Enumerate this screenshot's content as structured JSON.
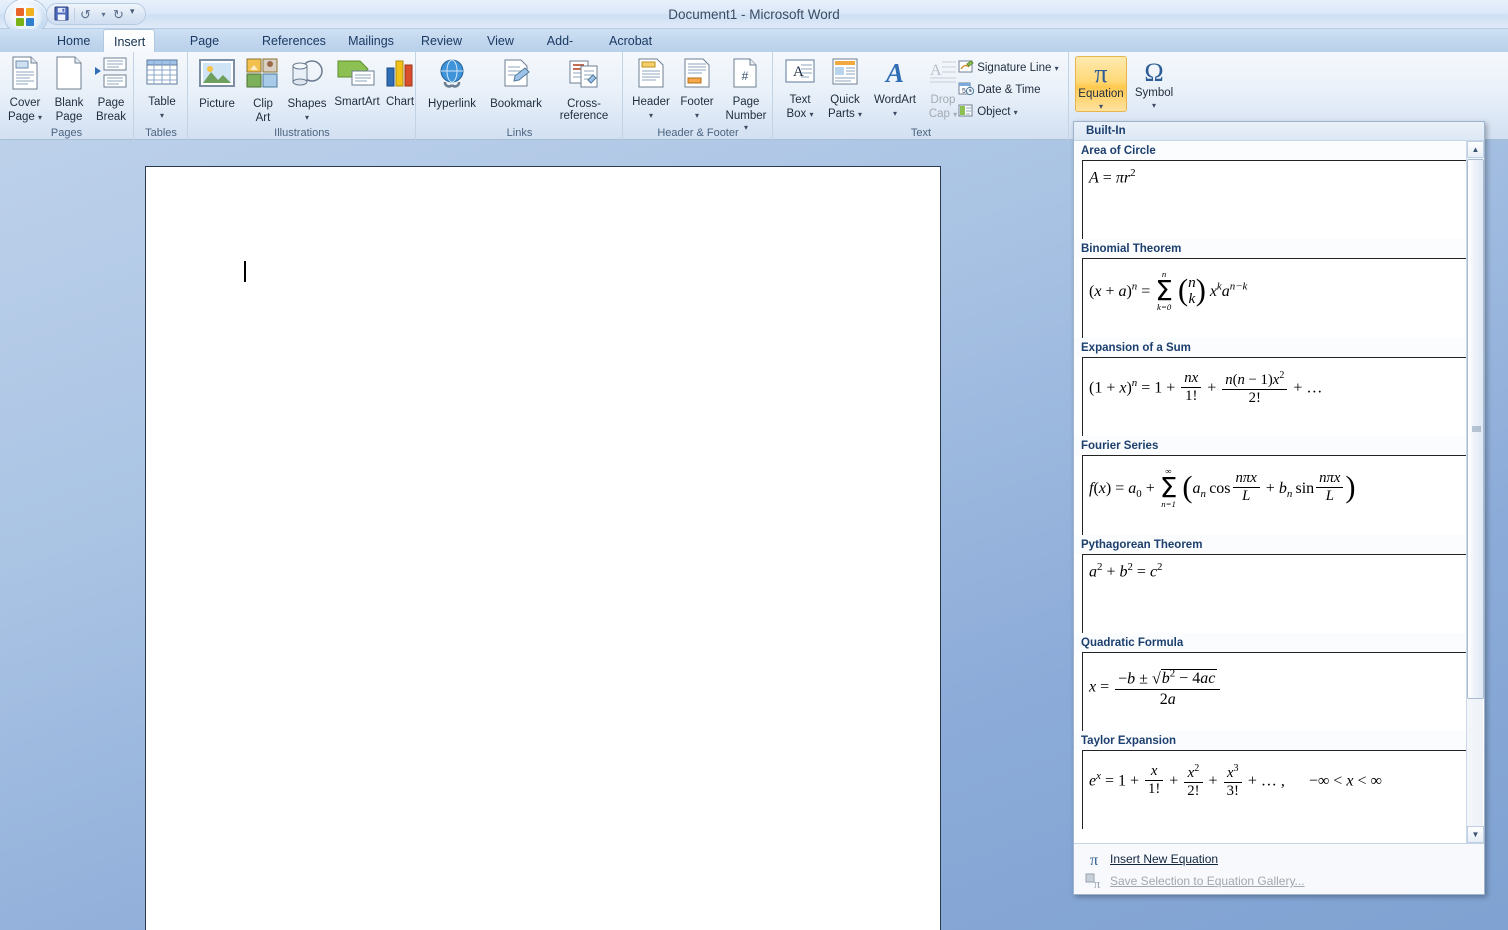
{
  "window": {
    "title": "Document1 - Microsoft Word"
  },
  "quick_access": {
    "items": [
      {
        "name": "save-button",
        "icon": "save-icon",
        "glyph": "💾"
      },
      {
        "name": "undo-button",
        "icon": "undo-icon",
        "glyph": "↶"
      },
      {
        "name": "undo-dropdown",
        "icon": "chevron-down-icon",
        "glyph": "▾"
      },
      {
        "name": "redo-button",
        "icon": "redo-icon",
        "glyph": "↷"
      }
    ],
    "customize_glyph": "▾"
  },
  "tabs": [
    {
      "label": "Home",
      "active": false
    },
    {
      "label": "Insert",
      "active": true
    },
    {
      "label": "Page Layout",
      "active": false
    },
    {
      "label": "References",
      "active": false
    },
    {
      "label": "Mailings",
      "active": false
    },
    {
      "label": "Review",
      "active": false
    },
    {
      "label": "View",
      "active": false
    },
    {
      "label": "Add-Ins",
      "active": false
    },
    {
      "label": "Acrobat",
      "active": false
    }
  ],
  "ribbon": {
    "groups": [
      {
        "label": "Pages",
        "buttons": [
          {
            "line1": "Cover",
            "line2": "Page",
            "caret": "▾",
            "icon": "cover-page-icon"
          },
          {
            "line1": "Blank",
            "line2": "Page",
            "caret": "",
            "icon": "blank-page-icon"
          },
          {
            "line1": "Page",
            "line2": "Break",
            "caret": "",
            "icon": "page-break-icon"
          }
        ]
      },
      {
        "label": "Tables",
        "buttons": [
          {
            "line1": "Table",
            "line2": "",
            "caret": "▾",
            "icon": "table-icon"
          }
        ]
      },
      {
        "label": "Illustrations",
        "buttons": [
          {
            "line1": "Picture",
            "line2": "",
            "caret": "",
            "icon": "picture-icon"
          },
          {
            "line1": "Clip",
            "line2": "Art",
            "caret": "",
            "icon": "clip-art-icon"
          },
          {
            "line1": "Shapes",
            "line2": "",
            "caret": "▾",
            "icon": "shapes-icon"
          },
          {
            "line1": "SmartArt",
            "line2": "",
            "caret": "",
            "icon": "smartart-icon"
          },
          {
            "line1": "Chart",
            "line2": "",
            "caret": "",
            "icon": "chart-icon"
          }
        ]
      },
      {
        "label": "Links",
        "buttons": [
          {
            "line1": "Hyperlink",
            "line2": "",
            "caret": "",
            "icon": "hyperlink-icon"
          },
          {
            "line1": "Bookmark",
            "line2": "",
            "caret": "",
            "icon": "bookmark-icon"
          },
          {
            "line1": "Cross-reference",
            "line2": "",
            "caret": "",
            "icon": "cross-reference-icon"
          }
        ]
      },
      {
        "label": "Header & Footer",
        "buttons": [
          {
            "line1": "Header",
            "line2": "",
            "caret": "▾",
            "icon": "header-icon"
          },
          {
            "line1": "Footer",
            "line2": "",
            "caret": "▾",
            "icon": "footer-icon"
          },
          {
            "line1": "Page",
            "line2": "Number",
            "caret": "▾",
            "icon": "page-number-icon"
          }
        ]
      },
      {
        "label": "Text",
        "buttons": [
          {
            "line1": "Text",
            "line2": "Box",
            "caret": "▾",
            "icon": "text-box-icon"
          },
          {
            "line1": "Quick",
            "line2": "Parts",
            "caret": "▾",
            "icon": "quick-parts-icon"
          },
          {
            "line1": "WordArt",
            "line2": "",
            "caret": "▾",
            "icon": "wordart-icon"
          },
          {
            "line1": "Drop",
            "line2": "Cap",
            "caret": "▾",
            "icon": "drop-cap-icon",
            "disabled": true
          }
        ],
        "small_buttons": [
          {
            "label": "Signature Line",
            "caret": "▾",
            "icon": "signature-line-icon"
          },
          {
            "label": "Date & Time",
            "caret": "",
            "icon": "date-time-icon"
          },
          {
            "label": "Object",
            "caret": "▾",
            "icon": "object-icon"
          }
        ]
      },
      {
        "label": "",
        "buttons": [
          {
            "line1": "Equation",
            "line2": "",
            "caret": "▾",
            "icon": "pi-icon",
            "glyph": "π",
            "selected": true
          },
          {
            "line1": "Symbol",
            "line2": "",
            "caret": "▾",
            "icon": "omega-icon",
            "glyph": "Ω",
            "selected": false
          }
        ]
      }
    ]
  },
  "gallery": {
    "header": "Built-In",
    "scrollbar": {
      "up_glyph": "▲",
      "down_glyph": "▼"
    },
    "items": [
      {
        "label": "Area of Circle",
        "equation_id": "area-of-circle"
      },
      {
        "label": "Binomial Theorem",
        "equation_id": "binomial-theorem"
      },
      {
        "label": "Expansion of a Sum",
        "equation_id": "expansion-of-a-sum"
      },
      {
        "label": "Fourier Series",
        "equation_id": "fourier-series"
      },
      {
        "label": "Pythagorean Theorem",
        "equation_id": "pythagorean-theorem"
      },
      {
        "label": "Quadratic Formula",
        "equation_id": "quadratic-formula"
      },
      {
        "label": "Taylor Expansion",
        "equation_id": "taylor-expansion"
      }
    ],
    "commands": [
      {
        "label": "Insert New Equation",
        "icon": "pi-icon",
        "glyph": "π",
        "disabled": false
      },
      {
        "label": "Save Selection to Equation Gallery...",
        "icon": "save-equation-icon",
        "glyph": "π",
        "disabled": true
      }
    ]
  },
  "document": {
    "cursor_visible": true
  },
  "colors": {
    "accent_selected": "#ffd978",
    "tab_text": "#1b3a63",
    "gallery_label": "#1c3f6e",
    "desktop_bg": "#8cabd8"
  }
}
